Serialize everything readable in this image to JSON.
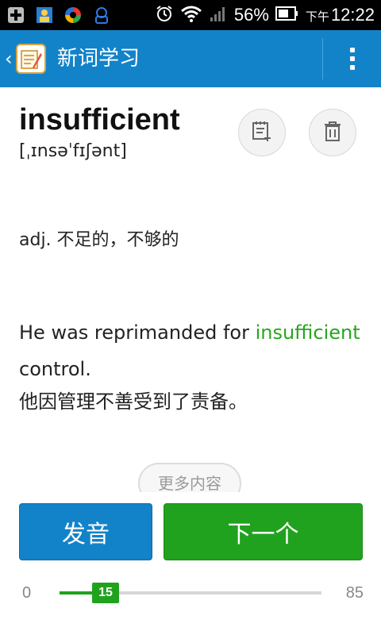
{
  "status_bar": {
    "battery_percent": "56%",
    "ampm": "下午",
    "time": "12:22"
  },
  "app_bar": {
    "back_label": "‹",
    "title": "新词学习"
  },
  "word": {
    "text": "insufficient",
    "phonetic": "[ˌɪnsəˈfɪʃənt]",
    "definition": "adj. 不足的，不够的",
    "example_before": "He was reprimanded for ",
    "example_highlight": "insufficient",
    "example_after": " control.",
    "translation": "他因管理不善受到了责备。"
  },
  "buttons": {
    "more": "更多内容",
    "pronounce": "发音",
    "next": "下一个"
  },
  "progress": {
    "min_label": "0",
    "max_label": "85",
    "current": "15",
    "min": 0,
    "max": 85,
    "value": 15
  },
  "colors": {
    "app_bar": "#1383c9",
    "accent_green": "#21a21f",
    "highlight_green": "#29a51f"
  },
  "icons": {
    "status_left": [
      "notification-plus-icon",
      "contacts-app-icon",
      "browser-app-icon",
      "game-pad-icon"
    ],
    "status_right": [
      "alarm-icon",
      "wifi-icon",
      "signal-icon",
      "battery-icon"
    ],
    "actions": [
      "add-note-icon",
      "trash-icon"
    ]
  }
}
